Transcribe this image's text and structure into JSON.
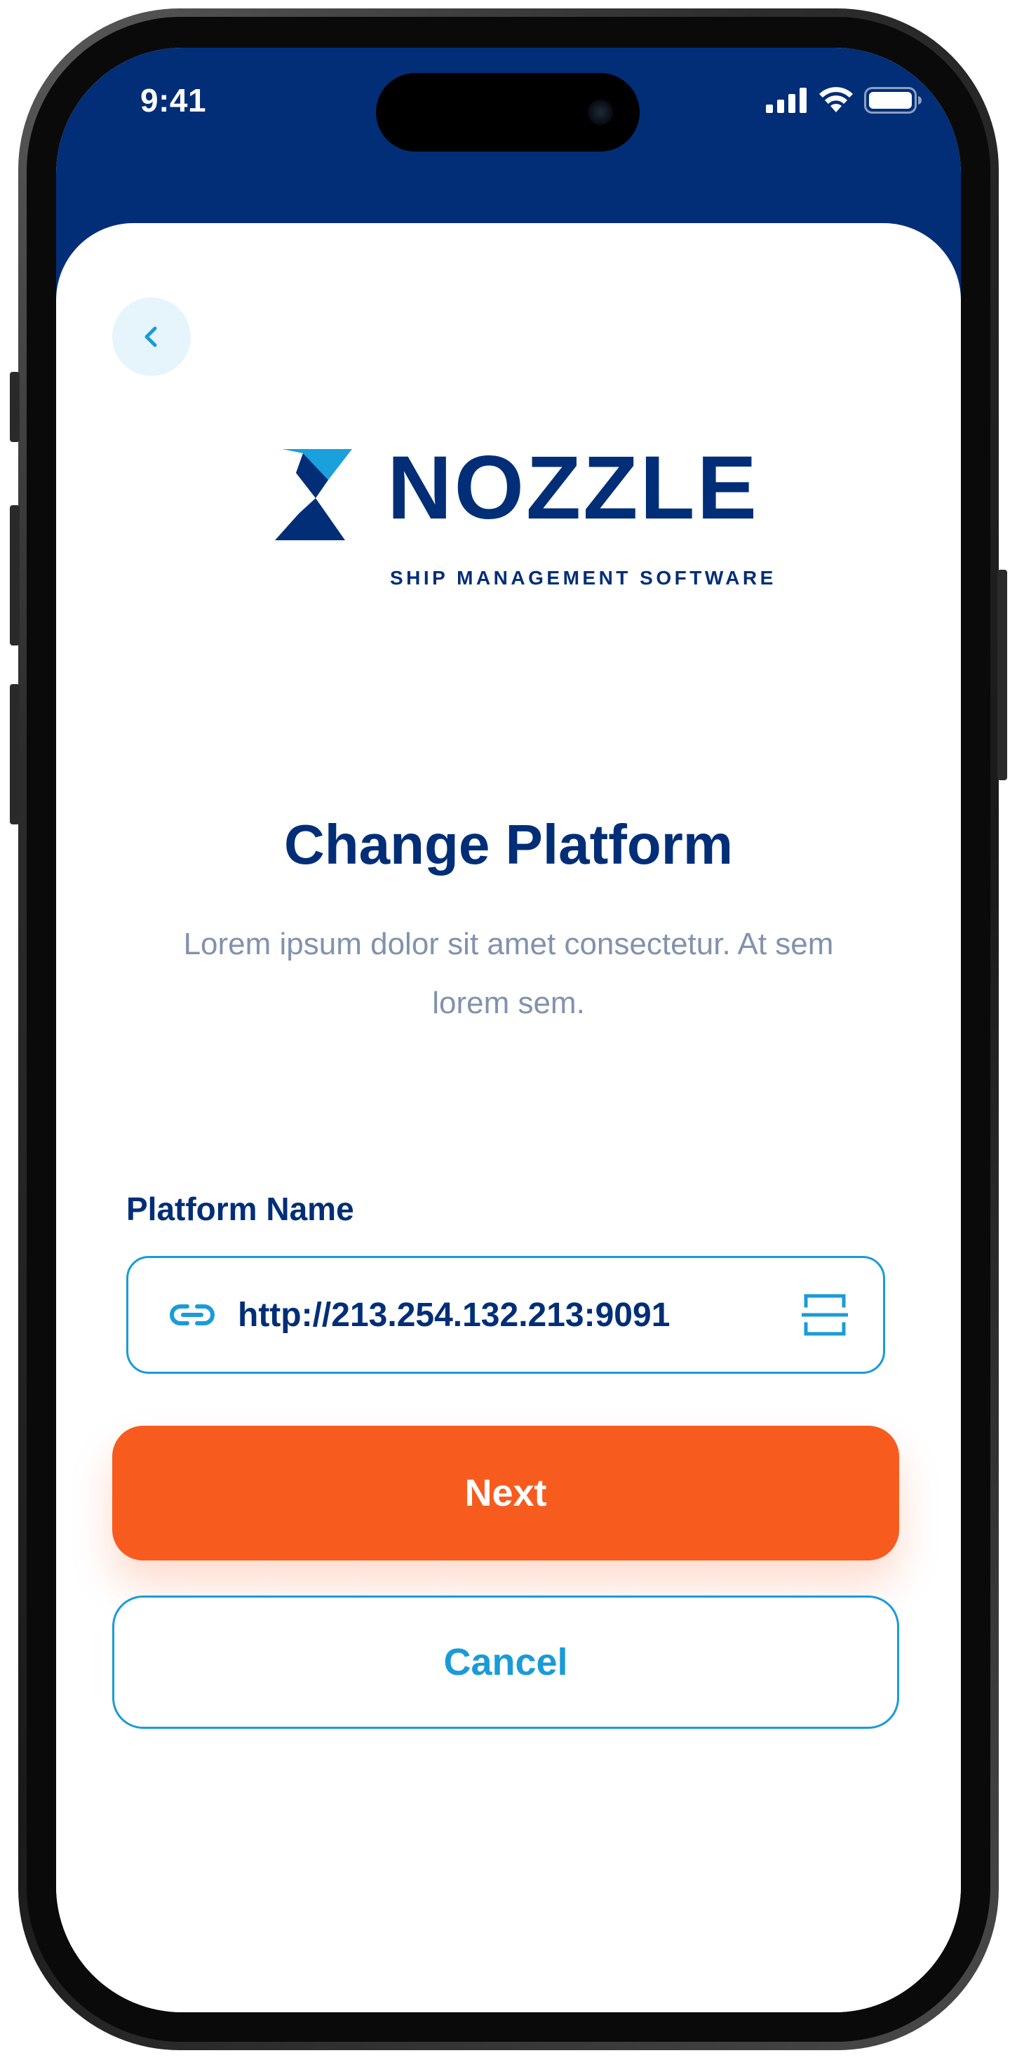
{
  "status_bar": {
    "time": "9:41"
  },
  "logo": {
    "wordmark": "NOZZLE",
    "tagline": "SHIP MANAGEMENT SOFTWARE"
  },
  "page": {
    "title": "Change Platform",
    "description": "Lorem ipsum dolor sit amet consectetur. At sem lorem sem."
  },
  "form": {
    "platform_label": "Platform Name",
    "platform_value": "http://213.254.132.213:9091",
    "link_icon": "link-icon",
    "scan_icon": "scan-icon"
  },
  "actions": {
    "next_label": "Next",
    "cancel_label": "Cancel"
  },
  "colors": {
    "header": "#012e77",
    "primary_text": "#012e77",
    "accent_blue": "#1a9bd8",
    "next_button": "#f75b1e",
    "muted_text": "#8192ad",
    "back_button_bg": "#e6f5fc"
  }
}
